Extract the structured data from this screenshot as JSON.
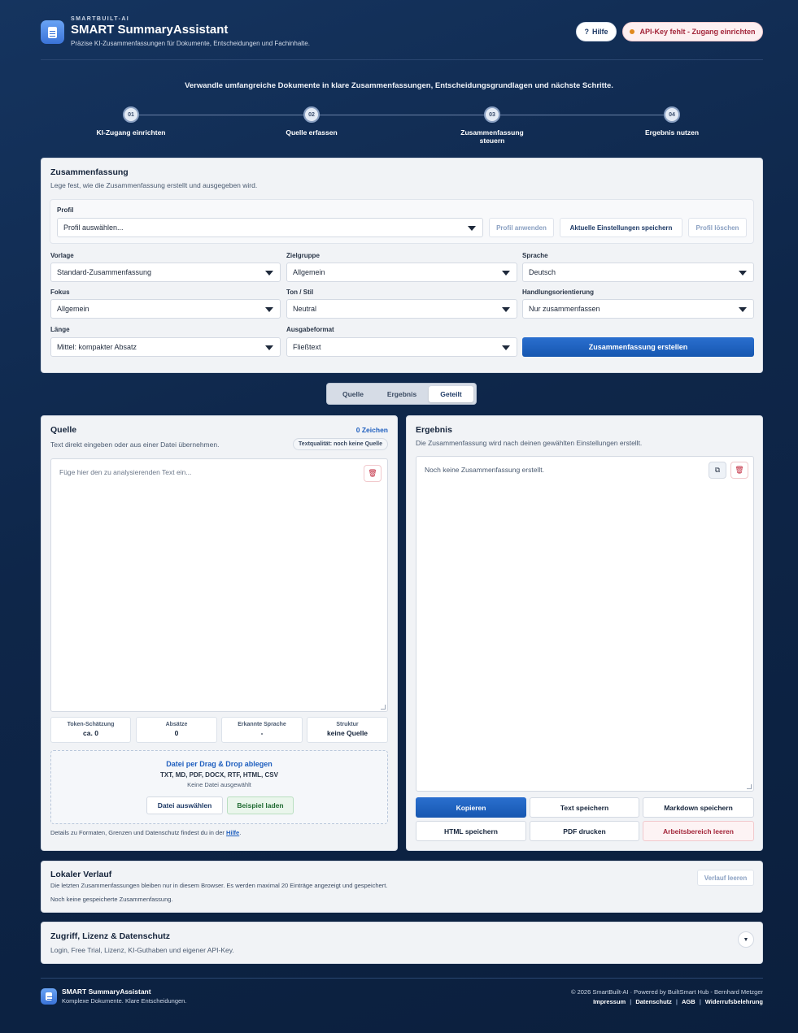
{
  "header": {
    "brand_small": "SMARTBUILT-AI",
    "title": "SMART SummaryAssistant",
    "subtitle": "Präzise KI-Zusammenfassungen für Dokumente, Entscheidungen und Fachinhalte.",
    "help_label": "Hilfe",
    "help_icon": "?",
    "api_warning": "API-Key fehlt - Zugang einrichten"
  },
  "intro": "Verwandle umfangreiche Dokumente in klare Zusammenfassungen, Entscheidungsgrundlagen und nächste Schritte.",
  "steps": [
    {
      "num": "01",
      "label": "KI-Zugang einrichten"
    },
    {
      "num": "02",
      "label": "Quelle erfassen"
    },
    {
      "num": "03",
      "label": "Zusammenfassung steuern"
    },
    {
      "num": "04",
      "label": "Ergebnis nutzen"
    }
  ],
  "settings": {
    "title": "Zusammenfassung",
    "subtitle": "Lege fest, wie die Zusammenfassung erstellt und ausgegeben wird.",
    "profile_label": "Profil",
    "profile_value": "Profil auswählen...",
    "apply_profile": "Profil anwenden",
    "save_settings": "Aktuelle Einstellungen speichern",
    "delete_profile": "Profil löschen",
    "fields": {
      "vorlage": {
        "label": "Vorlage",
        "value": "Standard-Zusammenfassung"
      },
      "zielgruppe": {
        "label": "Zielgruppe",
        "value": "Allgemein"
      },
      "sprache": {
        "label": "Sprache",
        "value": "Deutsch"
      },
      "fokus": {
        "label": "Fokus",
        "value": "Allgemein"
      },
      "ton": {
        "label": "Ton / Stil",
        "value": "Neutral"
      },
      "handlung": {
        "label": "Handlungsorientierung",
        "value": "Nur zusammenfassen"
      },
      "laenge": {
        "label": "Länge",
        "value": "Mittel: kompakter Absatz"
      },
      "format": {
        "label": "Ausgabeformat",
        "value": "Fließtext"
      }
    },
    "create_button": "Zusammenfassung erstellen"
  },
  "view_tabs": [
    "Quelle",
    "Ergebnis",
    "Geteilt"
  ],
  "source": {
    "title": "Quelle",
    "char_count": "0 Zeichen",
    "subtitle": "Text direkt eingeben oder aus einer Datei übernehmen.",
    "quality": "Textqualität: noch keine Quelle",
    "placeholder": "Füge hier den zu analysierenden Text ein...",
    "stats": [
      {
        "label": "Token-Schätzung",
        "value": "ca. 0"
      },
      {
        "label": "Absätze",
        "value": "0"
      },
      {
        "label": "Erkannte Sprache",
        "value": "-"
      },
      {
        "label": "Struktur",
        "value": "keine Quelle"
      }
    ],
    "drop_title": "Datei per Drag & Drop ablegen",
    "drop_formats": "TXT, MD, PDF, DOCX, RTF, HTML, CSV",
    "drop_none": "Keine Datei ausgewählt",
    "choose_file": "Datei auswählen",
    "load_example": "Beispiel laden",
    "note_prefix": "Details zu Formaten, Grenzen und Datenschutz findest du in der",
    "note_link": "Hilfe",
    "note_suffix": "."
  },
  "result": {
    "title": "Ergebnis",
    "subtitle": "Die Zusammenfassung wird nach deinen gewählten Einstellungen erstellt.",
    "empty": "Noch keine Zusammenfassung erstellt.",
    "buttons": {
      "copy": "Kopieren",
      "save_text": "Text speichern",
      "save_md": "Markdown speichern",
      "save_html": "HTML speichern",
      "print_pdf": "PDF drucken",
      "clear": "Arbeitsbereich leeren"
    }
  },
  "history": {
    "title": "Lokaler Verlauf",
    "subtitle": "Die letzten Zusammenfassungen bleiben nur in diesem Browser. Es werden maximal 20 Einträge angezeigt und gespeichert.",
    "empty": "Noch keine gespeicherte Zusammenfassung.",
    "clear": "Verlauf leeren"
  },
  "access": {
    "title": "Zugriff, Lizenz & Datenschutz",
    "subtitle": "Login, Free Trial, Lizenz, KI-Guthaben und eigener API-Key."
  },
  "footer": {
    "title": "SMART SummaryAssistant",
    "tagline": "Komplexe Dokumente. Klare Entscheidungen.",
    "copyright": "© 2026 SmartBuilt-AI · Powered by BuiltSmart Hub - Bernhard Metzger",
    "links": [
      "Impressum",
      "Datenschutz",
      "AGB",
      "Widerrufsbelehrung"
    ]
  }
}
